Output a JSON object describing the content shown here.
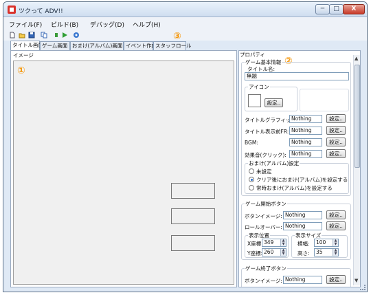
{
  "window": {
    "title": "ツクって ADV!!",
    "minimize": "─",
    "maximize": "□",
    "close": "X"
  },
  "menu": [
    "ファイル(F)",
    "ビルド(B)",
    "デバッグ(D)",
    "ヘルプ(H)"
  ],
  "toolbar_icons": [
    "new-file-icon",
    "open-folder-icon",
    "save-icon",
    "copy-icon",
    "build-icon",
    "run-icon",
    "help-icon"
  ],
  "tabs": [
    "タイトル画面",
    "ゲーム画面",
    "おまけ(アルバム)画面",
    "イベント作成",
    "スタッフロール"
  ],
  "markers": {
    "one": "①",
    "two": "②",
    "three": "③"
  },
  "left": {
    "group_label": "イメージ"
  },
  "props": {
    "header": "プロパティ",
    "game_info": {
      "legend": "ゲーム基本情報",
      "title_label": "タイトル名:",
      "title_value": "無題",
      "icon_legend": "アイコン",
      "icon_button": "設定..",
      "rows": [
        {
          "label": "タイトルグラフィック:",
          "value": "Nothing",
          "button": "設定.."
        },
        {
          "label": "タイトル表示前FR:",
          "value": "Nothing",
          "button": "設定.."
        },
        {
          "label": "BGM:",
          "value": "Nothing",
          "button": "設定.."
        },
        {
          "label": "効果音(クリック):",
          "value": "Nothing",
          "button": "設定.."
        }
      ],
      "omake": {
        "legend": "おまけ(アルバム)設定",
        "options": [
          "未設定",
          "クリア後におまけ(アルバム)を設定する",
          "常時おまけ(アルバム)を設定する"
        ],
        "selected_index": 1
      }
    },
    "start_button": {
      "legend": "ゲーム開始ボタン",
      "rows": [
        {
          "label": "ボタンイメージ:",
          "value": "Nothing",
          "button": "設定.."
        },
        {
          "label": "ロールオーバー:",
          "value": "Nothing",
          "button": "設定.."
        }
      ],
      "position": {
        "legend": "表示位置",
        "x_label": "X座標:",
        "x_value": "349",
        "y_label": "Y座標:",
        "y_value": "260"
      },
      "size": {
        "legend": "表示サイズ",
        "w_label": "横幅:",
        "w_value": "100",
        "h_label": "高さ:",
        "h_value": "35"
      }
    },
    "end_button": {
      "legend": "ゲーム終了ボタン",
      "rows": [
        {
          "label": "ボタンイメージ:",
          "value": "Nothing",
          "button": "設定.."
        }
      ]
    }
  },
  "colors": {
    "marker": "#f59a12",
    "close_button": "#c73a28",
    "window_frame": "#dfe9f5"
  }
}
